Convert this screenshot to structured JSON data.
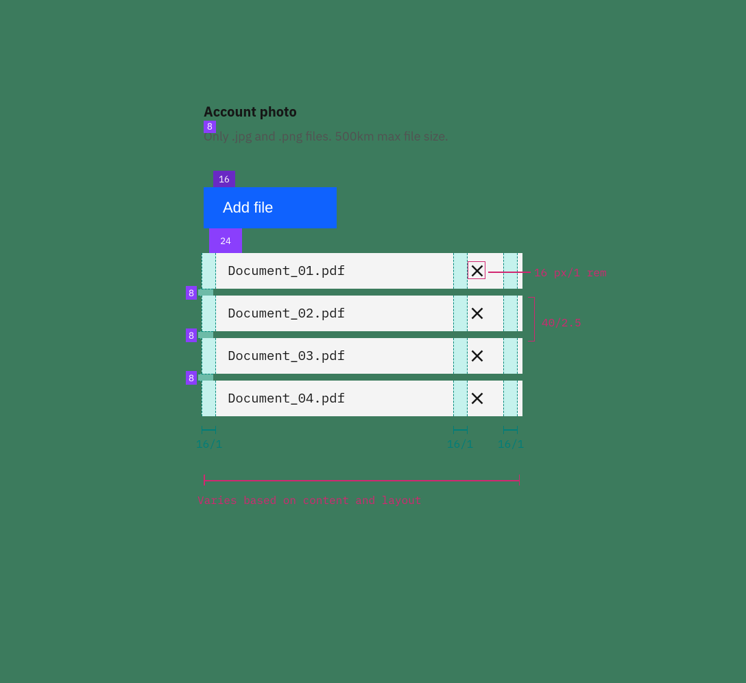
{
  "uploader": {
    "title": "Account photo",
    "description": "Only .jpg and .png files. 500km max file size.",
    "button_label": "Add file"
  },
  "spacers": {
    "s8": "8",
    "s16": "16",
    "s24": "24"
  },
  "files": [
    {
      "name": "Document_01.pdf"
    },
    {
      "name": "Document_02.pdf"
    },
    {
      "name": "Document_03.pdf"
    },
    {
      "name": "Document_04.pdf"
    }
  ],
  "annotations": {
    "close_size": "16 px/1 rem",
    "row_height": "40/2.5",
    "width_note": "Varies based on content and layout",
    "pad_left": "16/1",
    "pad_mid": "16/1",
    "pad_right": "16/1"
  }
}
